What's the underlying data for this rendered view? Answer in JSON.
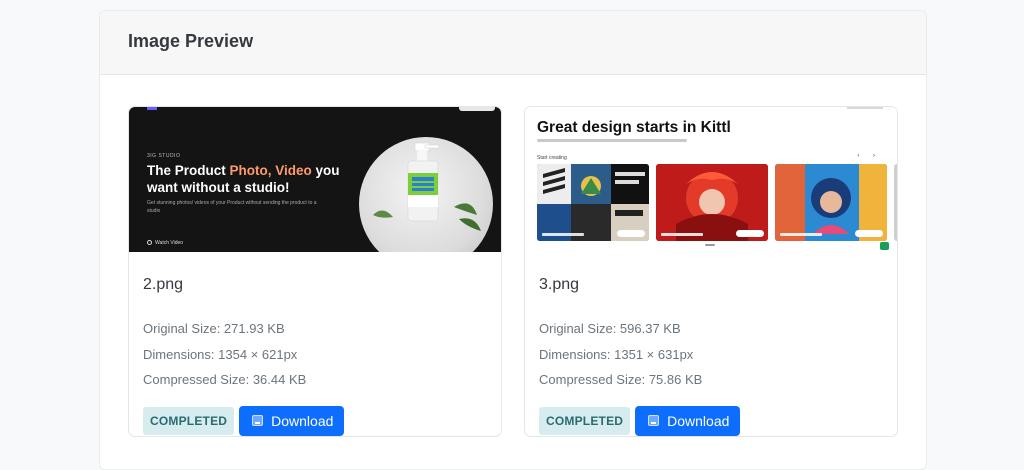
{
  "header": {
    "title": "Image Preview"
  },
  "cards": [
    {
      "file_name": "2.png",
      "original_size": "Original Size: 271.93 KB",
      "dimensions": "Dimensions: 1354 × 621px",
      "compressed_size": "Compressed Size: 36.44 KB",
      "status": "COMPLETED",
      "download_label": "Download",
      "thumbnail": {
        "studio": "3IG STUDIO",
        "headline_pre": "The Product ",
        "headline_accent": "Photo, Video",
        "headline_post": " you want without a studio!",
        "subtext": "Get stunning photos/ videos of your Product without sending the product to a studio",
        "watch": "Watch Video",
        "accent_color": "#ff9b6a"
      }
    },
    {
      "file_name": "3.png",
      "original_size": "Original Size: 596.37 KB",
      "dimensions": "Dimensions: 1351 × 631px",
      "compressed_size": "Compressed Size: 75.86 KB",
      "status": "COMPLETED",
      "download_label": "Download",
      "thumbnail": {
        "headline": "Great design starts in Kittl",
        "start_label": "Start creating",
        "arrows": "‹ ›"
      }
    }
  ],
  "colors": {
    "primary": "#0d6efd",
    "badge_bg": "#d7ecef",
    "badge_text": "#2a6b72"
  },
  "icons": {
    "download": "download-icon"
  }
}
